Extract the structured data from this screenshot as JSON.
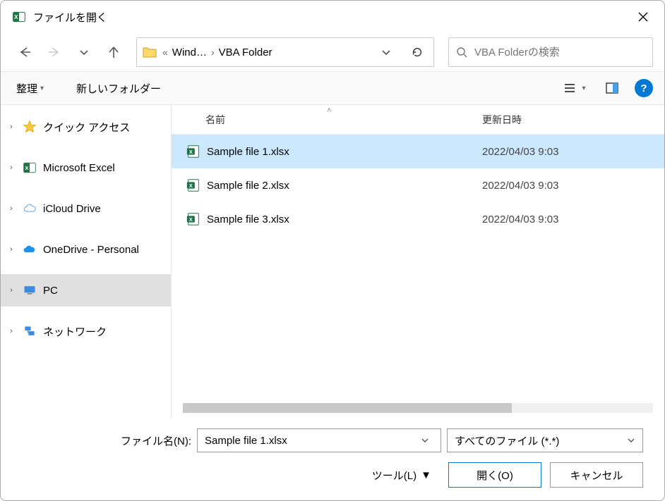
{
  "titlebar": {
    "title": "ファイルを開く"
  },
  "breadcrumb": {
    "prefix": "«",
    "item1": "Wind…",
    "item2": "VBA Folder"
  },
  "search": {
    "placeholder": "VBA Folderの検索"
  },
  "toolbar": {
    "organize": "整理",
    "new_folder": "新しいフォルダー"
  },
  "sidebar": {
    "items": [
      {
        "label": "クイック アクセス",
        "icon": "star"
      },
      {
        "label": "Microsoft Excel",
        "icon": "excel"
      },
      {
        "label": "iCloud Drive",
        "icon": "icloud"
      },
      {
        "label": "OneDrive - Personal",
        "icon": "onedrive"
      },
      {
        "label": "PC",
        "icon": "pc",
        "selected": true
      },
      {
        "label": "ネットワーク",
        "icon": "network"
      }
    ]
  },
  "columns": {
    "name": "名前",
    "date": "更新日時"
  },
  "files": [
    {
      "name": "Sample file 1.xlsx",
      "date": "2022/04/03 9:03",
      "selected": true
    },
    {
      "name": "Sample file 2.xlsx",
      "date": "2022/04/03 9:03",
      "selected": false
    },
    {
      "name": "Sample file 3.xlsx",
      "date": "2022/04/03 9:03",
      "selected": false
    }
  ],
  "bottom": {
    "filename_label": "ファイル名(N):",
    "filename_value": "Sample file 1.xlsx",
    "filetype_label": "すべてのファイル (*.*)",
    "tools_label": "ツール(L)",
    "open_label": "開く(O)",
    "cancel_label": "キャンセル"
  }
}
